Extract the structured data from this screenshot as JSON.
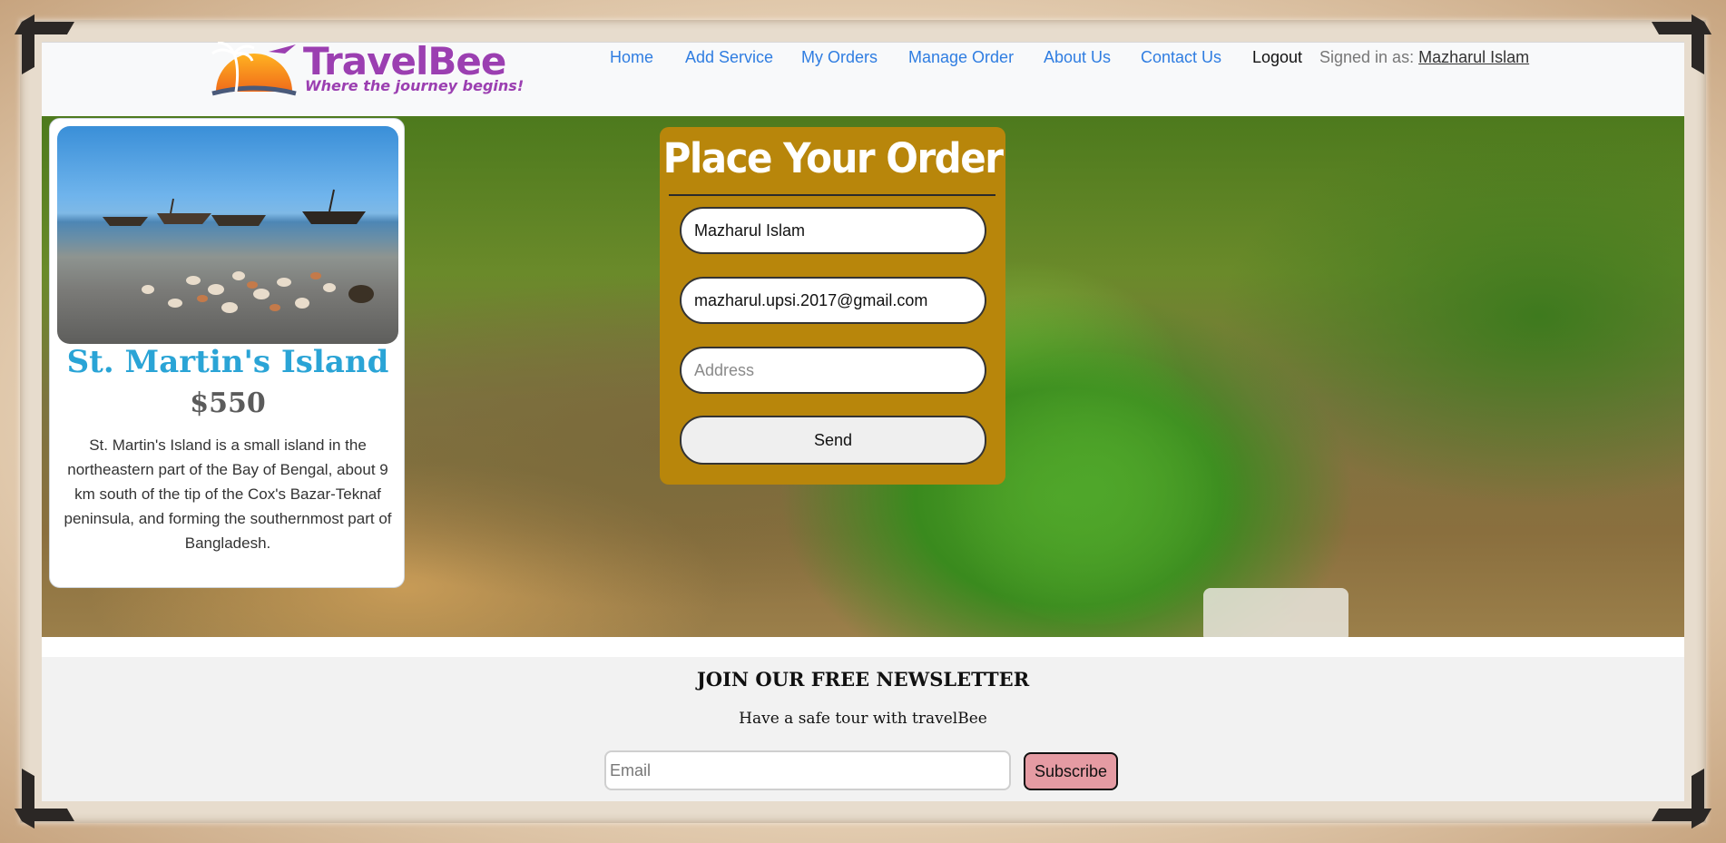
{
  "brand": {
    "name": "TravelBee",
    "tagline": "Where the journey begins!"
  },
  "nav": {
    "links": [
      "Home",
      "Add Service",
      "My Orders",
      "Manage Order",
      "About Us",
      "Contact Us"
    ],
    "logout": "Logout",
    "signed_in_label": "Signed in as:",
    "signed_in_user": "Mazharul Islam"
  },
  "service": {
    "title": "St. Martin's Island",
    "price": "$550",
    "description": "St. Martin's Island is a small island in the northeastern part of the Bay of Bengal, about 9 km south of the tip of the Cox's Bazar-Teknaf peninsula, and forming the southernmost part of Bangladesh."
  },
  "order": {
    "title": "Place Your Order",
    "name_value": "Mazharul Islam",
    "email_value": "mazharul.upsi.2017@gmail.com",
    "address_placeholder": "Address",
    "send_label": "Send"
  },
  "newsletter": {
    "title": "JOIN OUR FREE NEWSLETTER",
    "subtitle": "Have a safe tour with travelBee",
    "email_placeholder": "Email",
    "subscribe_label": "Subscribe"
  },
  "colors": {
    "nav_link": "#2f7de1",
    "order_bg": "#b8860b",
    "card_title": "#2aa4d6",
    "subscribe_bg": "#e59ba3",
    "brand_purple": "#9b3fb1"
  }
}
